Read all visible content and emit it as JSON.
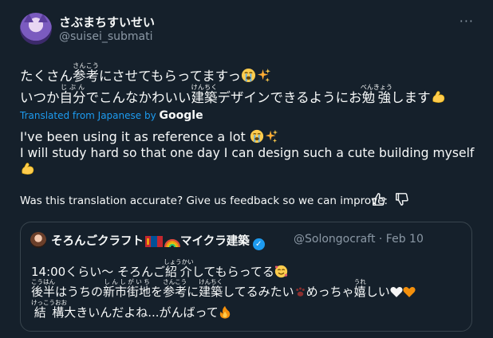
{
  "tweet": {
    "display_name": "さぶまちすいせい",
    "handle": "@suisei_submati",
    "more_icon": "more-horizontal-icon",
    "jp_line1": {
      "a": "たくさん",
      "b_base": "参考",
      "b_ruby": "さんこう",
      "c": "にさせてもらってますっ"
    },
    "jp_line2": {
      "a": "いつか",
      "b_base": "自分",
      "b_ruby": "じぶん",
      "c": "でこんなかわいい",
      "d_base": "建築",
      "d_ruby": "けんちく",
      "e": "デザインできるようにお",
      "f_base": "勉強",
      "f_ruby": "べんきょう",
      "g": "します"
    },
    "translated_label": "Translated from Japanese by",
    "translated_provider": "Google",
    "en_line1": "I've been using it as reference a lot",
    "en_line2": "I will study hard so that one day I can design such a cute building myself",
    "feedback_text": "Was this translation accurate? Give us feedback so we can improve:",
    "feedback_icons": [
      "thumbs-up-icon",
      "thumbs-down-icon"
    ]
  },
  "quote": {
    "display_name": "そろんごクラフト",
    "name_suffix": "マイクラ建築",
    "handle": "@Solongocraft",
    "separator": "·",
    "date": "Feb 10",
    "line1": {
      "a": "14:00くらい〜 そろんご",
      "b_base": "紹介",
      "b_ruby": "しょうかい",
      "c": "してもらってる"
    },
    "line2": {
      "a_base": "後半",
      "a_ruby": "こうはん",
      "b": "はうちの",
      "c_base": "新市街地",
      "c_ruby": "しんしがいち",
      "d": "を",
      "e_base": "参考",
      "e_ruby": "さんこう",
      "f": "に",
      "g_base": "建築",
      "g_ruby": "けんちく",
      "h": "してるみたい",
      "i": "めっちゃ",
      "j_base": "嬉",
      "j_ruby": "うれ",
      "k": "しい"
    },
    "line3": {
      "a_base": "結構",
      "a_ruby": "けっこうおお",
      "b": "大きいんだよね...がんばって"
    }
  },
  "colors": {
    "background": "#15202b",
    "text": "#f7f9f9",
    "muted": "#8b98a5",
    "accent": "#1d9bf0",
    "border": "#38444d"
  }
}
